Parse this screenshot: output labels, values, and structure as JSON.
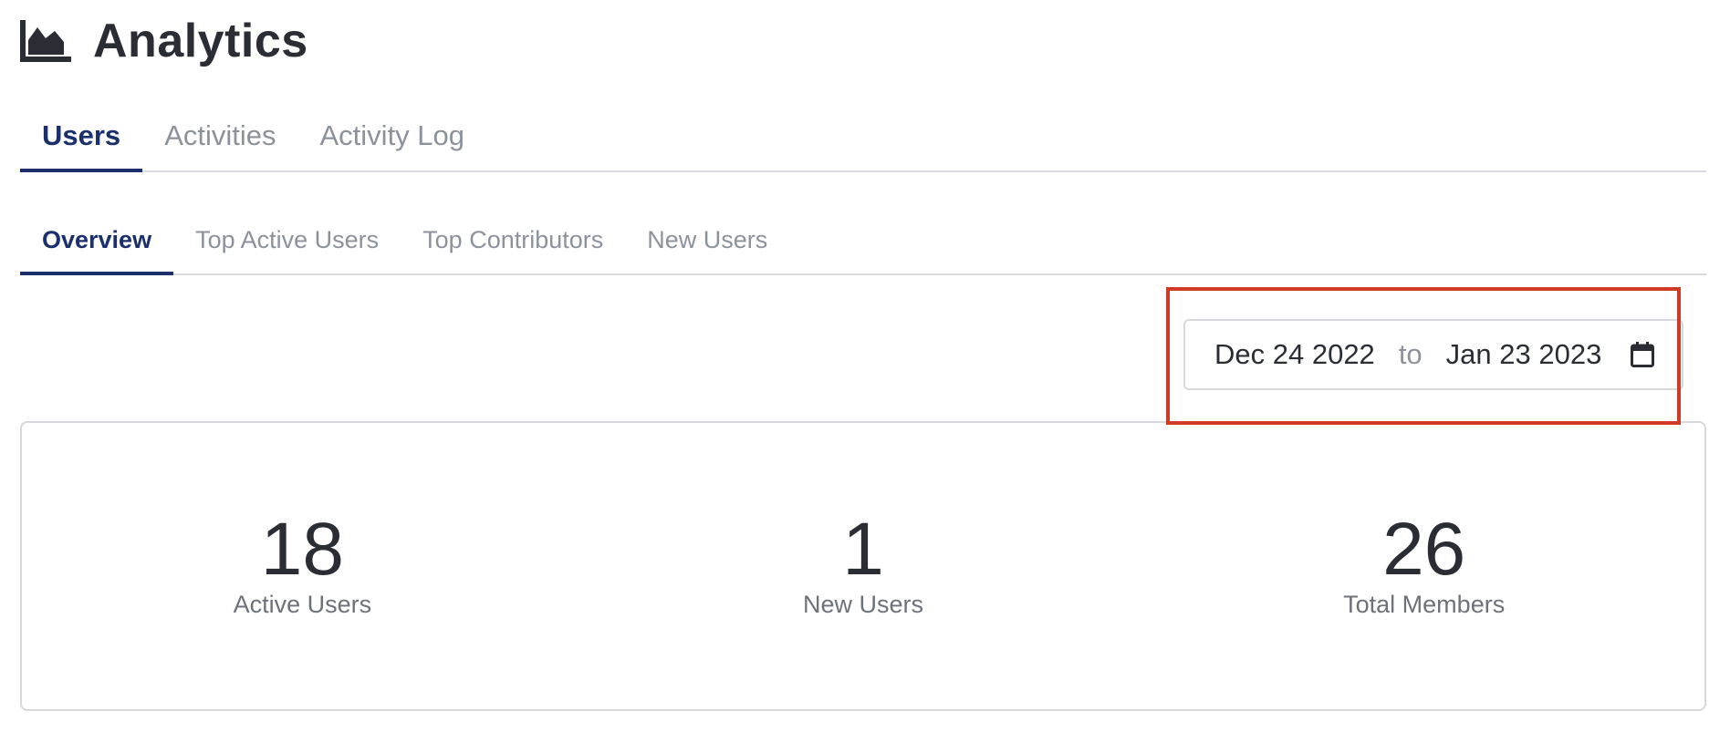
{
  "header": {
    "title": "Analytics",
    "icon": "area-chart-icon"
  },
  "main_tabs": [
    {
      "label": "Users",
      "active": true
    },
    {
      "label": "Activities",
      "active": false
    },
    {
      "label": "Activity Log",
      "active": false
    }
  ],
  "sub_tabs": [
    {
      "label": "Overview",
      "active": true
    },
    {
      "label": "Top Active Users",
      "active": false
    },
    {
      "label": "Top Contributors",
      "active": false
    },
    {
      "label": "New Users",
      "active": false
    }
  ],
  "date_range": {
    "start": "Dec 24 2022",
    "separator": "to",
    "end": "Jan 23 2023",
    "icon": "calendar-icon"
  },
  "stats": [
    {
      "value": "18",
      "label": "Active Users"
    },
    {
      "value": "1",
      "label": "New Users"
    },
    {
      "value": "26",
      "label": "Total Members"
    }
  ],
  "colors": {
    "accent": "#1a2f6b",
    "text": "#2a2d34",
    "muted": "#8c929c",
    "highlight": "#d13b24",
    "border": "#d6d8dc"
  }
}
